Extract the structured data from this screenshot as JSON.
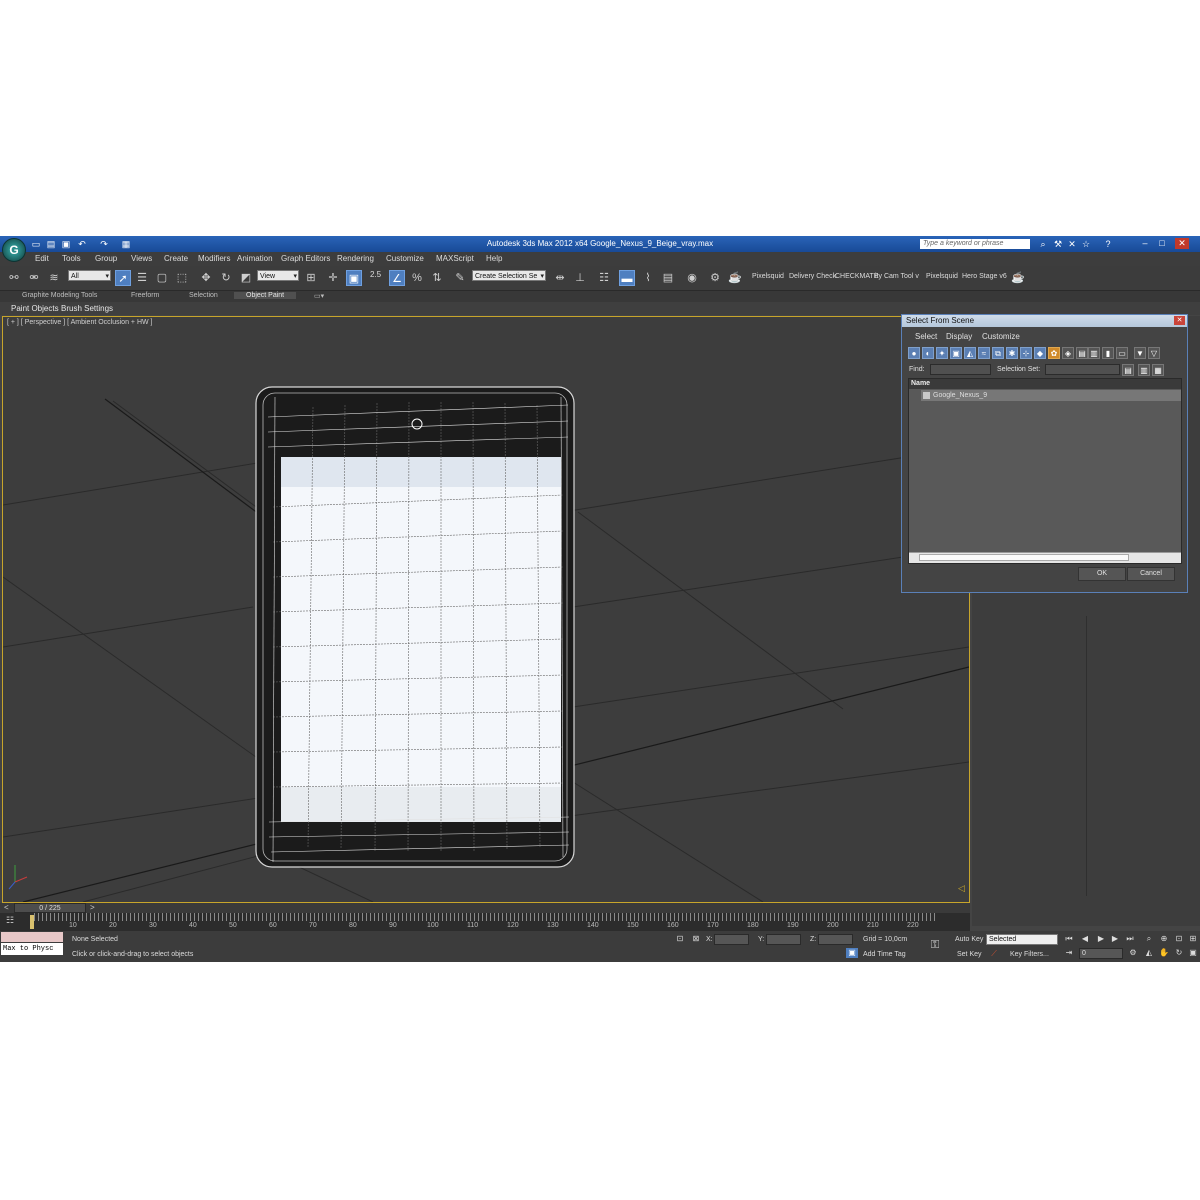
{
  "window": {
    "title": "Autodesk 3ds Max  2012 x64       Google_Nexus_9_Beige_vray.max",
    "search_placeholder": "Type a keyword or phrase",
    "logo": "3ds-max-logo"
  },
  "menu": [
    "Edit",
    "Tools",
    "Group",
    "Views",
    "Create",
    "Modifiers",
    "Animation",
    "Graph Editors",
    "Rendering",
    "Customize",
    "MAXScript",
    "Help"
  ],
  "toolbar": {
    "filter_value": "All",
    "refcoord_value": "View",
    "snap_label": "2.5",
    "selection_set_placeholder": "Create Selection Se",
    "plugins": [
      "Pixelsquid",
      "Delivery Check",
      "CHECKMATE",
      "ity Cam Tool v",
      "Pixelsquid",
      "Hero Stage v6"
    ]
  },
  "ribbon": {
    "tabs": [
      "Graphite Modeling Tools",
      "Freeform",
      "Selection",
      "Object Paint"
    ],
    "active_tab": "Object Paint",
    "sub_items": [
      "Paint Objects",
      "Brush Settings"
    ]
  },
  "viewport": {
    "label": "[ + ] [ Perspective ] [ Ambient Occlusion + HW ]"
  },
  "dialog": {
    "title": "Select From Scene",
    "menu": [
      "Select",
      "Display",
      "Customize"
    ],
    "find_label": "Find:",
    "selection_set_label": "Selection Set:",
    "column_name": "Name",
    "items": [
      "Google_Nexus_9"
    ],
    "ok_label": "OK",
    "cancel_label": "Cancel"
  },
  "timeline": {
    "frame_display": "0 / 225",
    "ticks": [
      "10",
      "20",
      "30",
      "40",
      "50",
      "60",
      "70",
      "80",
      "90",
      "100",
      "110",
      "120",
      "130",
      "140",
      "150",
      "160",
      "170",
      "180",
      "190",
      "200",
      "210",
      "220"
    ]
  },
  "status": {
    "maxscript_label": "Max to Physc",
    "selection_status": "None Selected",
    "prompt": "Click or click-and-drag to select objects",
    "x_label": "X:",
    "y_label": "Y:",
    "z_label": "Z:",
    "grid": "Grid = 10,0cm",
    "add_time_tag": "Add Time Tag",
    "auto_key": "Auto Key",
    "auto_key_value": "Selected",
    "set_key": "Set Key",
    "key_filters": "Key Filters...",
    "current_frame": "0"
  }
}
